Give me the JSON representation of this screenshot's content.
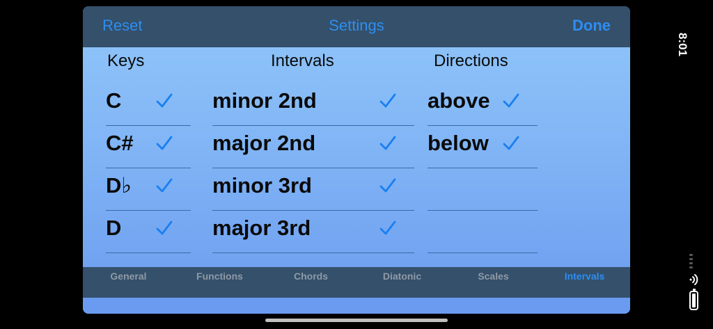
{
  "status": {
    "time": "8:01"
  },
  "nav": {
    "reset_label": "Reset",
    "title": "Settings",
    "done_label": "Done"
  },
  "columns": {
    "keys": {
      "header": "Keys",
      "items": [
        {
          "label": "C",
          "checked": true
        },
        {
          "label": "C#",
          "checked": true
        },
        {
          "label": "D♭",
          "checked": true
        },
        {
          "label": "D",
          "checked": true
        }
      ]
    },
    "intervals": {
      "header": "Intervals",
      "items": [
        {
          "label": "minor 2nd",
          "checked": true
        },
        {
          "label": "major 2nd",
          "checked": true
        },
        {
          "label": "minor 3rd",
          "checked": true
        },
        {
          "label": "major 3rd",
          "checked": true
        }
      ]
    },
    "directions": {
      "header": "Directions",
      "items": [
        {
          "label": "above",
          "checked": true
        },
        {
          "label": "below",
          "checked": true
        },
        {
          "label": "",
          "checked": false
        },
        {
          "label": "",
          "checked": false
        }
      ]
    }
  },
  "tabs": [
    {
      "label": "General",
      "active": false
    },
    {
      "label": "Functions",
      "active": false
    },
    {
      "label": "Chords",
      "active": false
    },
    {
      "label": "Diatonic",
      "active": false
    },
    {
      "label": "Scales",
      "active": false
    },
    {
      "label": "Intervals",
      "active": true
    }
  ],
  "colors": {
    "accent": "#2d8ef2",
    "bar": "#34506b",
    "check": "#1a7ff0"
  }
}
